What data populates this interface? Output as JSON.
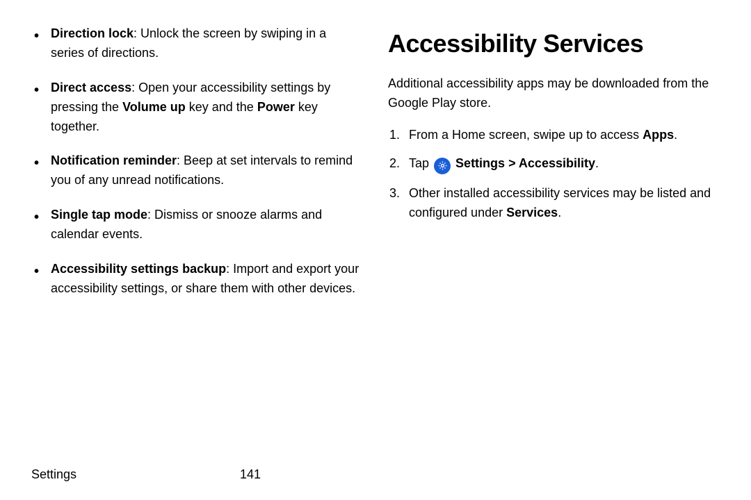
{
  "left": {
    "bullets": [
      {
        "term": "Direction lock",
        "desc": ": Unlock the screen by swiping in a series of directions."
      },
      {
        "term": "Direct access",
        "desc_pre": ": Open your accessibility settings by pressing the ",
        "bold1": "Volume up",
        "mid": " key and the ",
        "bold2": "Power",
        "desc_post": " key together."
      },
      {
        "term": "Notification reminder",
        "desc": ": Beep at set intervals to remind you of any unread notifications."
      },
      {
        "term": "Single tap mode",
        "desc": ": Dismiss or snooze alarms and calendar events."
      },
      {
        "term": "Accessibility settings backup",
        "desc": ": Import and export your accessibility settings, or share them with other devices."
      }
    ]
  },
  "right": {
    "heading": "Accessibility Services",
    "intro": "Additional accessibility apps may be downloaded from the Google Play store.",
    "steps": {
      "s1_pre": "From a Home screen, swipe up to access ",
      "s1_bold": "Apps",
      "s1_post": ".",
      "s2_pre": "Tap ",
      "s2_settings": "Settings",
      "s2_sep": " > ",
      "s2_acc": "Accessibility",
      "s2_post": ".",
      "s3_pre": "Other installed accessibility services may be listed and configured under ",
      "s3_bold": "Services",
      "s3_post": "."
    }
  },
  "footer": {
    "section": "Settings",
    "page": "141"
  }
}
